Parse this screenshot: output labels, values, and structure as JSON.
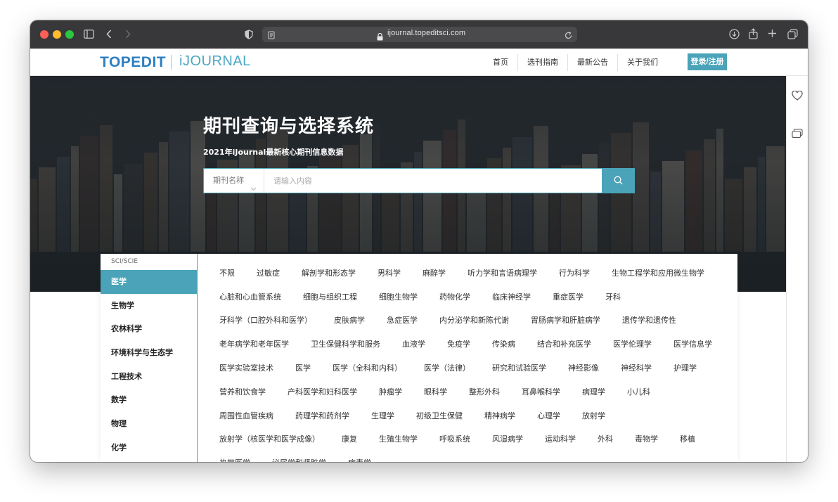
{
  "browser": {
    "url": "ijournal.topeditsci.com"
  },
  "header": {
    "logo_primary": "TOPEDIT",
    "logo_secondary": "iJOURNAL",
    "nav": [
      "首页",
      "选刊指南",
      "最新公告",
      "关于我们"
    ],
    "login_label": "登录/注册"
  },
  "hero": {
    "title": "期刊查询与选择系统",
    "subtitle": "2021年iJournal最新核心期刊信息数据",
    "search": {
      "type_label": "期刊名称",
      "placeholder": "请输入内容"
    }
  },
  "categories": {
    "group_label": "SCI/SCIE",
    "items": [
      "医学",
      "生物学",
      "农林科学",
      "环境科学与生态学",
      "工程技术",
      "数学",
      "物理",
      "化学"
    ],
    "active_index": 0
  },
  "subjects": [
    [
      "不限",
      "过敏症",
      "解剖学和形态学",
      "男科学",
      "麻醉学",
      "听力学和言语病理学",
      "行为科学",
      "生物工程学和应用微生物学"
    ],
    [
      "心脏和心血管系统",
      "细胞与组织工程",
      "细胞生物学",
      "药物化学",
      "临床神经学",
      "重症医学",
      "牙科"
    ],
    [
      "牙科学（口腔外科和医学）",
      "皮肤病学",
      "急症医学",
      "内分泌学和新陈代谢",
      "胃肠病学和肝脏病学",
      "遗传学和遗传性"
    ],
    [
      "老年病学和老年医学",
      "卫生保健科学和服务",
      "血液学",
      "免疫学",
      "传染病",
      "结合和补充医学",
      "医学伦理学",
      "医学信息学"
    ],
    [
      "医学实验室技术",
      "医学",
      "医学（全科和内科）",
      "医学（法律）",
      "研究和试验医学",
      "神经影像",
      "神经科学",
      "护理学"
    ],
    [
      "营养和饮食学",
      "产科医学和妇科医学",
      "肿瘤学",
      "眼科学",
      "整形外科",
      "耳鼻喉科学",
      "病理学",
      "小儿科"
    ],
    [
      "周围性血管疾病",
      "药理学和药剂学",
      "生理学",
      "初级卫生保健",
      "精神病学",
      "心理学",
      "放射学"
    ],
    [
      "放射学（核医学和医学成像）",
      "康复",
      "生殖生物学",
      "呼吸系统",
      "风湿病学",
      "运动科学",
      "外科",
      "毒物学",
      "移植"
    ],
    [
      "热带医学",
      "泌尿学和肾脏学",
      "病毒学"
    ]
  ],
  "colors": {
    "accent": "#4aa3b8",
    "logo_blue": "#2c7fc1",
    "chrome": "#38383a"
  }
}
